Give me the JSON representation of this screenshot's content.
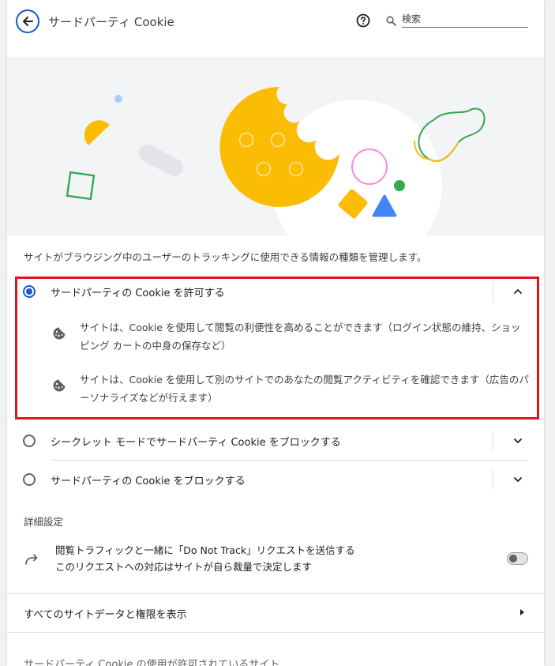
{
  "header": {
    "title": "サードパーティ Cookie",
    "search_placeholder": "検索"
  },
  "description": "サイトがブラウジング中のユーザーのトラッキングに使用できる情報の種類を管理します。",
  "options": [
    {
      "label": "サードパーティの Cookie を許可する",
      "selected": true,
      "expanded": true,
      "details": [
        "サイトは、Cookie を使用して閲覧の利便性を高めることができます（ログイン状態の維持、ショッピング カートの中身の保存など）",
        "サイトは、Cookie を使用して別のサイトでのあなたの閲覧アクティビティを確認できます（広告のパーソナライズなどが行えます）"
      ]
    },
    {
      "label": "シークレット モードでサードパーティ Cookie をブロックする",
      "selected": false,
      "expanded": false
    },
    {
      "label": "サードパーティの Cookie をブロックする",
      "selected": false,
      "expanded": false
    }
  ],
  "advanced": {
    "title": "詳細設定",
    "dnt_line1": "閲覧トラフィックと一緒に「Do Not Track」リクエストを送信する",
    "dnt_line2": "このリクエストへの対応はサイトが自ら裁量で決定します",
    "dnt_enabled": false
  },
  "all_site_data_link": "すべてのサイトデータと権限を表示",
  "allowed_sites_title": "サードパーティ Cookie の使用が許可されているサイト",
  "icons": [
    "back-arrow-icon",
    "help-icon",
    "search-icon",
    "cookie-icon",
    "chevron-up-icon",
    "chevron-down-icon",
    "redirect-arrow-icon",
    "arrow-right-icon"
  ],
  "colors": {
    "accent": "#1a57c9",
    "highlight": "#e0141e",
    "cookie_yellow": "#fbbc04",
    "green": "#34a853",
    "blue": "#4285f4",
    "pink": "#f48fd8"
  }
}
